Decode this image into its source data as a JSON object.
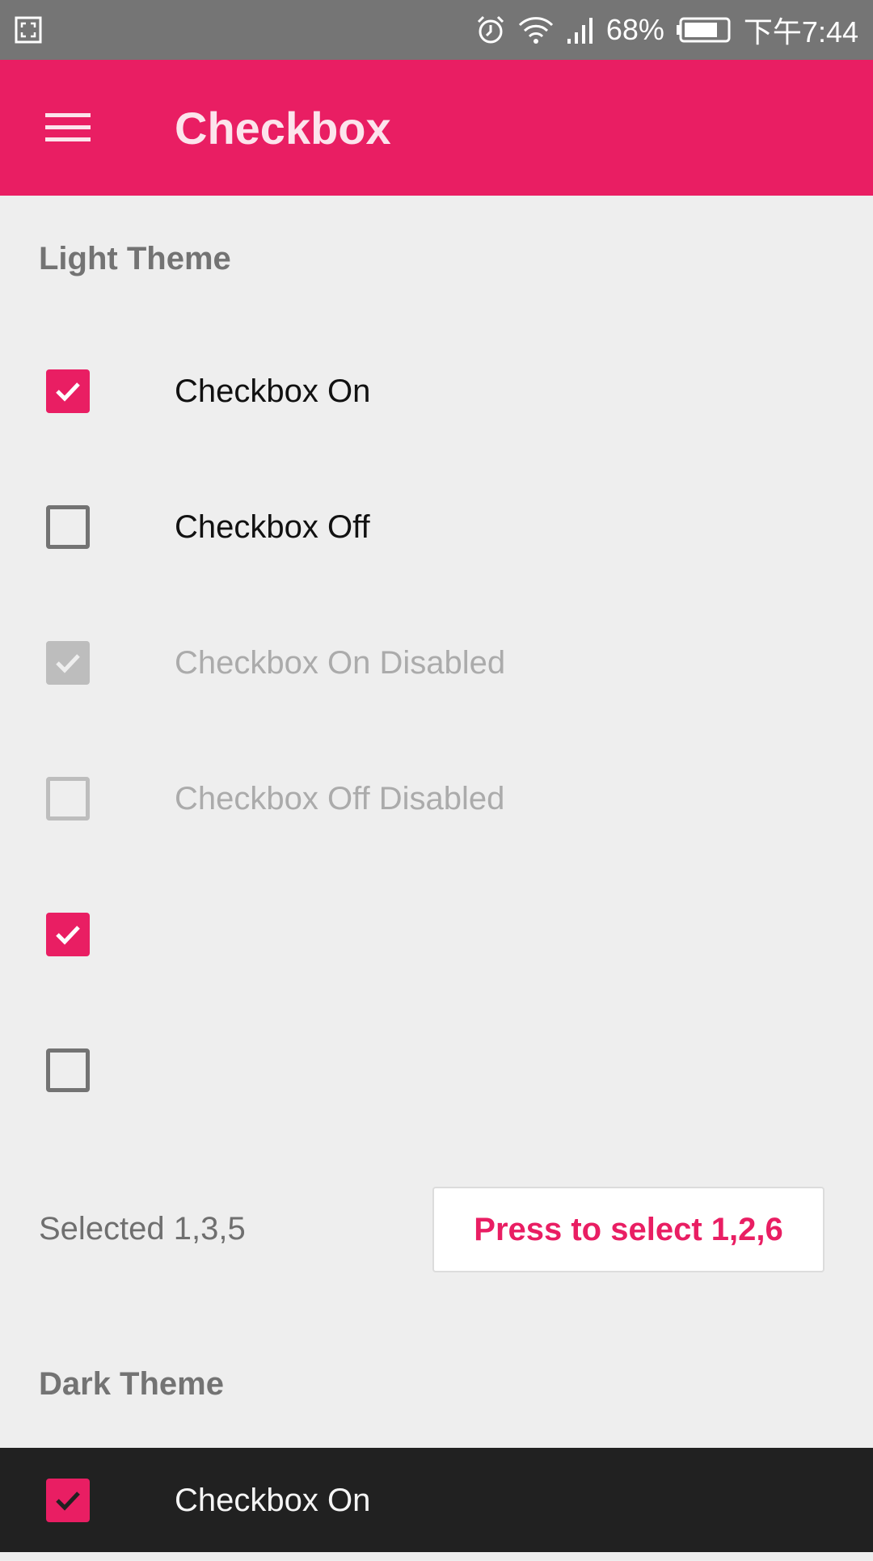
{
  "status_bar": {
    "battery_percent": "68%",
    "time": "下午7:44",
    "icons": [
      "screenshot-icon",
      "alarm-icon",
      "wifi-icon",
      "signal-icon",
      "battery-icon"
    ]
  },
  "app_bar": {
    "title": "Checkbox",
    "menu_icon": "hamburger-menu-icon",
    "color": "#e91e63"
  },
  "light_theme": {
    "title": "Light Theme",
    "items": [
      {
        "label": "Checkbox On",
        "checked": true,
        "disabled": false
      },
      {
        "label": "Checkbox Off",
        "checked": false,
        "disabled": false
      },
      {
        "label": "Checkbox On Disabled",
        "checked": true,
        "disabled": true
      },
      {
        "label": "Checkbox Off Disabled",
        "checked": false,
        "disabled": true
      },
      {
        "label": "",
        "checked": true,
        "disabled": false
      },
      {
        "label": "",
        "checked": false,
        "disabled": false
      }
    ],
    "selected_text": "Selected 1,3,5",
    "button_label": "Press to select 1,2,6"
  },
  "dark_theme": {
    "title": "Dark Theme",
    "items": [
      {
        "label": "Checkbox On",
        "checked": true,
        "disabled": false
      }
    ]
  },
  "colors": {
    "accent": "#e91e63",
    "background": "#eeeeee",
    "dark_background": "#212121"
  }
}
